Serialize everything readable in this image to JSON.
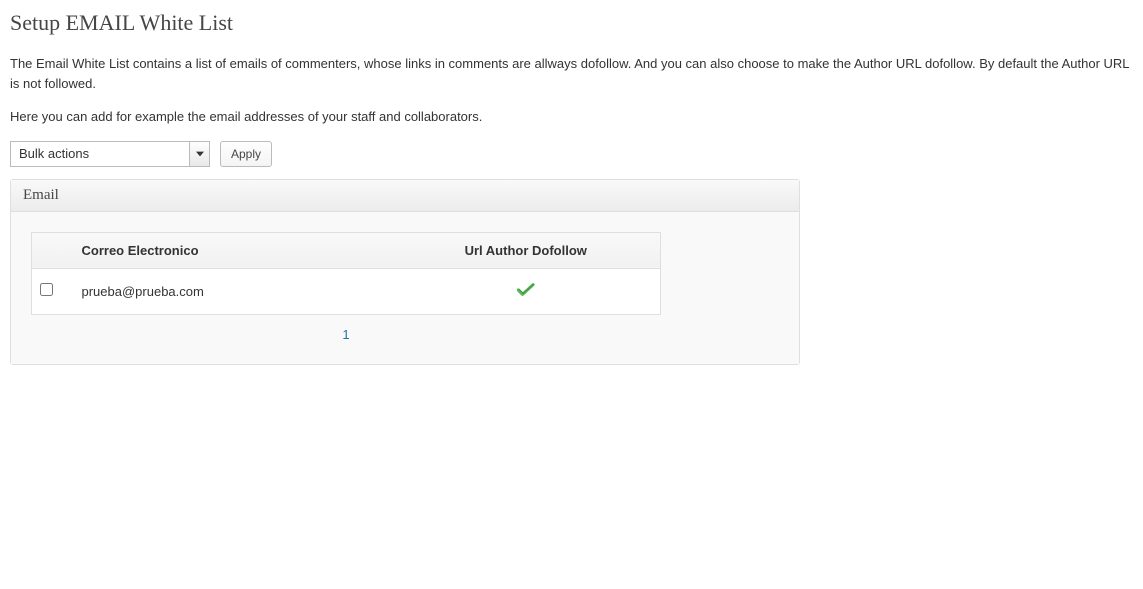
{
  "page": {
    "title": "Setup EMAIL White List",
    "description1": "The Email White List contains a list of emails of commenters, whose links in comments are allways dofollow. And you can also choose to make the Author URL dofollow. By default the Author URL is not followed.",
    "description2": "Here you can add for example the email addresses of your staff and collaborators."
  },
  "actions": {
    "bulk_select": "Bulk actions",
    "apply": "Apply"
  },
  "panel": {
    "title": "Email"
  },
  "table": {
    "headers": {
      "email": "Correo Electronico",
      "dofollow": "Url Author Dofollow"
    },
    "rows": [
      {
        "email": "prueba@prueba.com",
        "dofollow_checked": true
      }
    ]
  },
  "pagination": {
    "current": "1"
  }
}
